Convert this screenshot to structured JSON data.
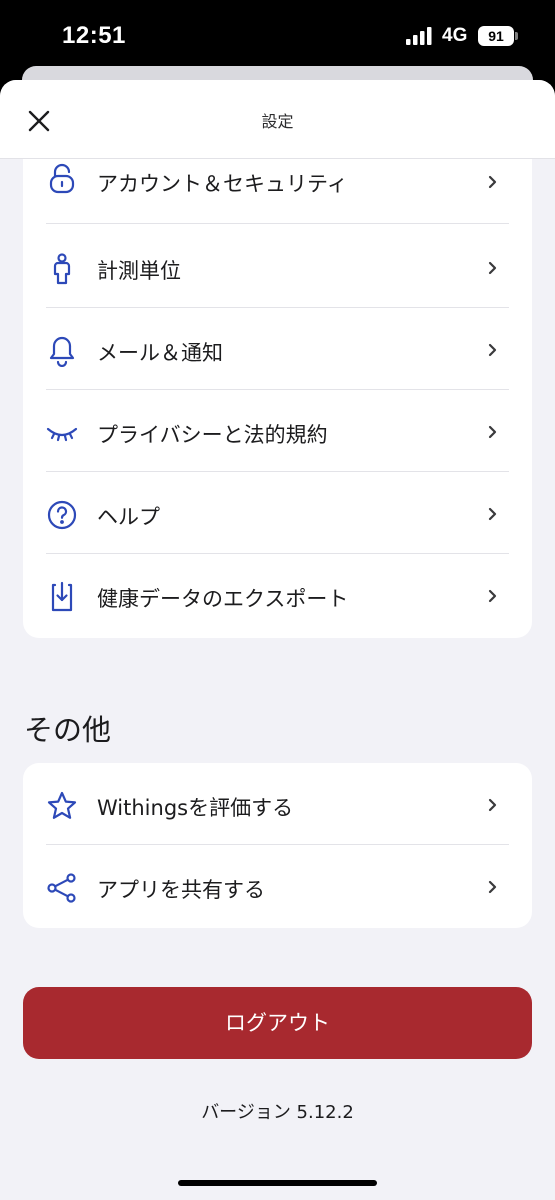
{
  "status_bar": {
    "time": "12:51",
    "network": "4G",
    "battery": "91"
  },
  "header": {
    "title": "設定",
    "close_icon": "close-icon"
  },
  "settings_items": [
    {
      "label": "アカウント＆セキュリティ",
      "icon": "lock-icon"
    },
    {
      "label": "計測単位",
      "icon": "person-icon"
    },
    {
      "label": "メール＆通知",
      "icon": "bell-icon"
    },
    {
      "label": "プライバシーと法的規約",
      "icon": "closed-eye-icon"
    },
    {
      "label": "ヘルプ",
      "icon": "help-icon"
    },
    {
      "label": "健康データのエクスポート",
      "icon": "export-icon"
    }
  ],
  "other_section": {
    "title": "その他",
    "items": [
      {
        "label": "Withingsを評価する",
        "icon": "star-icon"
      },
      {
        "label": "アプリを共有する",
        "icon": "share-icon"
      }
    ]
  },
  "logout_label": "ログアウト",
  "version": "バージョン 5.12.2",
  "colors": {
    "icon": "#2d49b8",
    "logout": "#a8292f",
    "background": "#f2f2f7"
  }
}
